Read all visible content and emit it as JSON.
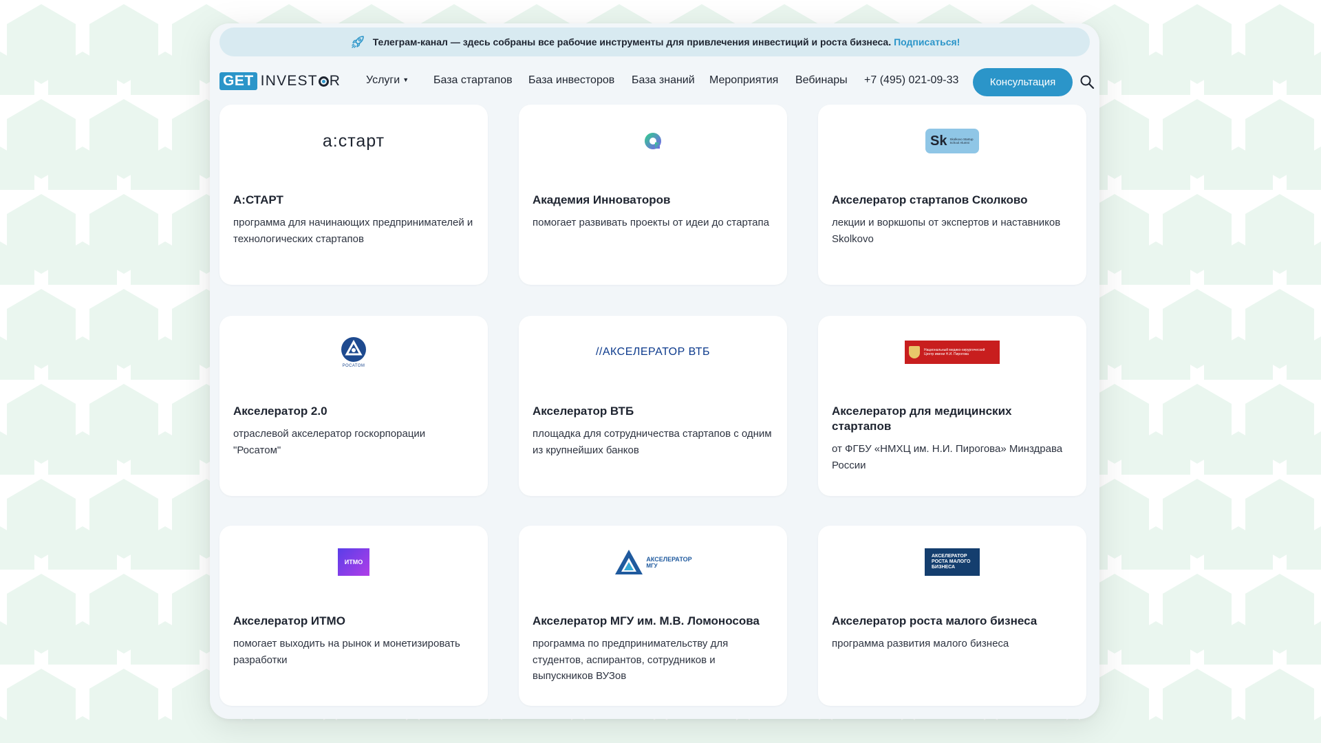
{
  "banner": {
    "text": "Телеграм-канал — здесь собраны все рабочие инструменты для привлечения инвестиций и роста бизнеса.",
    "link": "Подписаться!"
  },
  "logo": {
    "get": "GET",
    "investor_part1": "INVEST",
    "investor_part2": "R"
  },
  "nav": {
    "services": "Услуги",
    "startups": "База стартапов",
    "investors": "База инвесторов",
    "knowledge": "База знаний",
    "events": "Мероприятия",
    "webinars": "Вебинары",
    "phone": "+7 (495) 021-09-33",
    "cta": "Консультация"
  },
  "colors": {
    "accent": "#2b95c9",
    "text": "#1e2430",
    "page_bg": "#f2f6f9"
  },
  "cards": [
    {
      "title": "А:СТАРТ",
      "desc": "программа для начинающих предпринимателей и технологических стартапов",
      "logo_text": "а:старт",
      "icon": "astart-logo"
    },
    {
      "title": "Академия Инноваторов",
      "desc": "помогает развивать проекты от идеи до стартапа",
      "logo_text": "",
      "icon": "innovators-academy-logo"
    },
    {
      "title": "Акселератор стартапов Сколково",
      "desc": "лекции и воркшопы от экспертов и наставников Skolkovo",
      "logo_text": "Sk",
      "logo_subtext": "Skolkovo Startup School Alumni",
      "icon": "skolkovo-logo"
    },
    {
      "title": "Акселератор 2.0",
      "desc": "отраслевой акселератор госкорпорации \"Росатом\"",
      "logo_text": "РОСАТОМ",
      "icon": "rosatom-logo"
    },
    {
      "title": "Акселератор ВТБ",
      "desc": "площадка для сотрудничества стартапов с одним из крупнейших банков",
      "logo_text": "//АКСЕЛЕРАТОР ВТБ",
      "icon": "vtb-accelerator-logo"
    },
    {
      "title": "Акселератор для медицинских стартапов",
      "desc": "от ФГБУ «НМХЦ им. Н.И. Пирогова» Минздрава России",
      "logo_text": "Национальный медико-хирургический Центр имени Н.И. Пирогова",
      "icon": "pirogov-center-logo"
    },
    {
      "title": "Акселератор ИТМО",
      "desc": "помогает выходить на рынок и монетизировать разработки",
      "logo_text": "ИТМО",
      "icon": "itmo-logo"
    },
    {
      "title": "Акселератор МГУ им. М.В. Ломоносова",
      "desc": "программа по предпринимательству для студентов, аспирантов, сотрудников и выпускников ВУЗов",
      "logo_text": "АКСЕЛЕРАТОР",
      "logo_subtext": "МГУ",
      "icon": "msu-accelerator-logo"
    },
    {
      "title": "Акселератор роста малого бизнеса",
      "desc": "программа развития малого бизнеса",
      "logo_text": "АКСЕЛЕРАТОР РОСТА МАЛОГО БИЗНЕСА",
      "icon": "small-business-accelerator-logo"
    }
  ]
}
